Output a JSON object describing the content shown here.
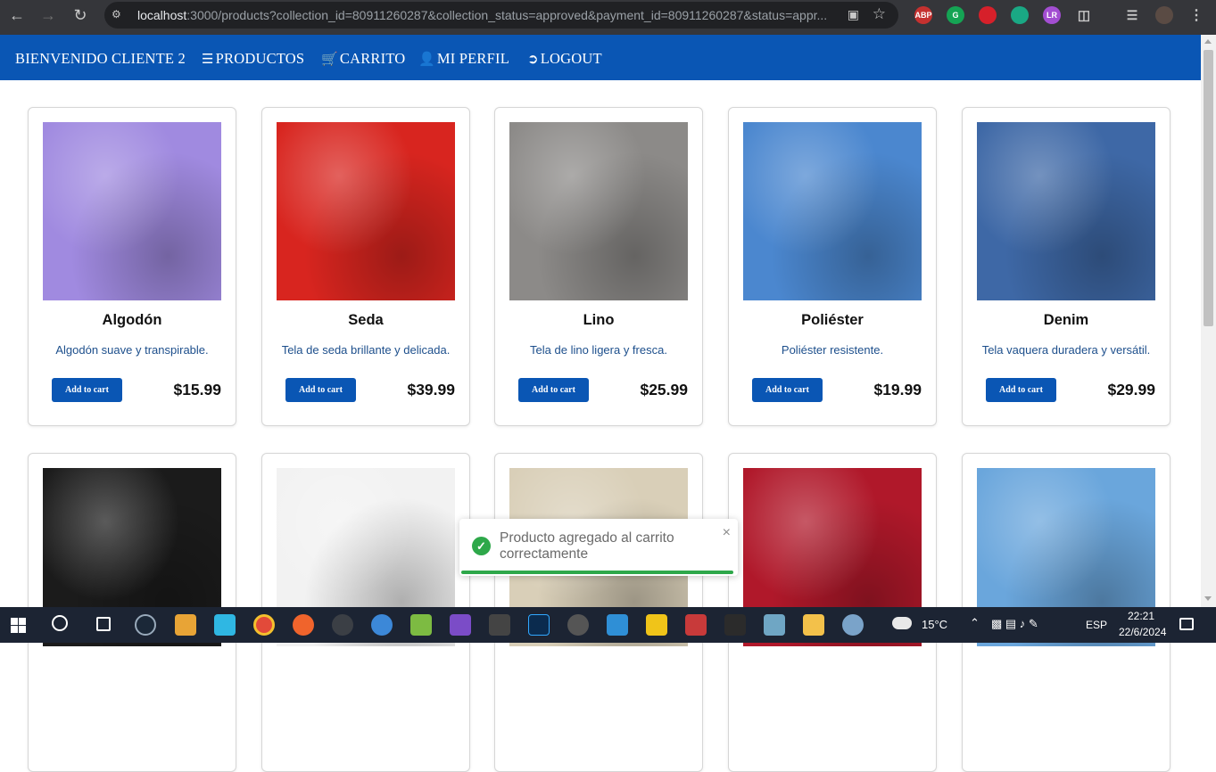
{
  "browser": {
    "url_host": "localhost",
    "url_path": ":3000/products?collection_id=80911260287&collection_status=approved&payment_id=80911260287&status=appr...",
    "extensions": [
      "ABP",
      "G",
      "",
      "",
      "LR"
    ]
  },
  "nav": {
    "welcome": "BIENVENIDO CLIENTE 2",
    "productos": "PRODUCTOS",
    "carrito": "CARRITO",
    "perfil": "MI PERFIL",
    "logout": "LOGOUT"
  },
  "products": [
    {
      "name": "Algodón",
      "desc": "Algodón suave y transpirable.",
      "price": "$15.99",
      "color": "#a08ae0",
      "button": "Add to cart"
    },
    {
      "name": "Seda",
      "desc": "Tela de seda brillante y delicada.",
      "price": "$39.99",
      "color": "#d8251f",
      "button": "Add to cart"
    },
    {
      "name": "Lino",
      "desc": "Tela de lino ligera y fresca.",
      "price": "$25.99",
      "color": "#8c8a88",
      "button": "Add to cart"
    },
    {
      "name": "Poliéster",
      "desc": "Poliéster resistente.",
      "price": "$19.99",
      "color": "#4b87cf",
      "button": "Add to cart"
    },
    {
      "name": "Denim",
      "desc": "Tela vaquera duradera y versátil.",
      "price": "$29.99",
      "color": "#3e68a6",
      "button": "Add to cart"
    },
    {
      "name": "",
      "desc": "",
      "price": "",
      "color": "#1b1b1b",
      "button": ""
    },
    {
      "name": "",
      "desc": "",
      "price": "",
      "color": "#f2f2f2",
      "button": ""
    },
    {
      "name": "",
      "desc": "",
      "price": "",
      "color": "#d9cfb8",
      "button": ""
    },
    {
      "name": "",
      "desc": "",
      "price": "",
      "color": "#b0182a",
      "button": ""
    },
    {
      "name": "",
      "desc": "",
      "price": "",
      "color": "#6aa6dc",
      "button": ""
    }
  ],
  "toast": {
    "message": "Producto agregado al carrito correctamente",
    "close": "×"
  },
  "taskbar": {
    "temperature": "15°C",
    "language": "ESP",
    "time": "22:21",
    "date": "22/6/2024"
  }
}
